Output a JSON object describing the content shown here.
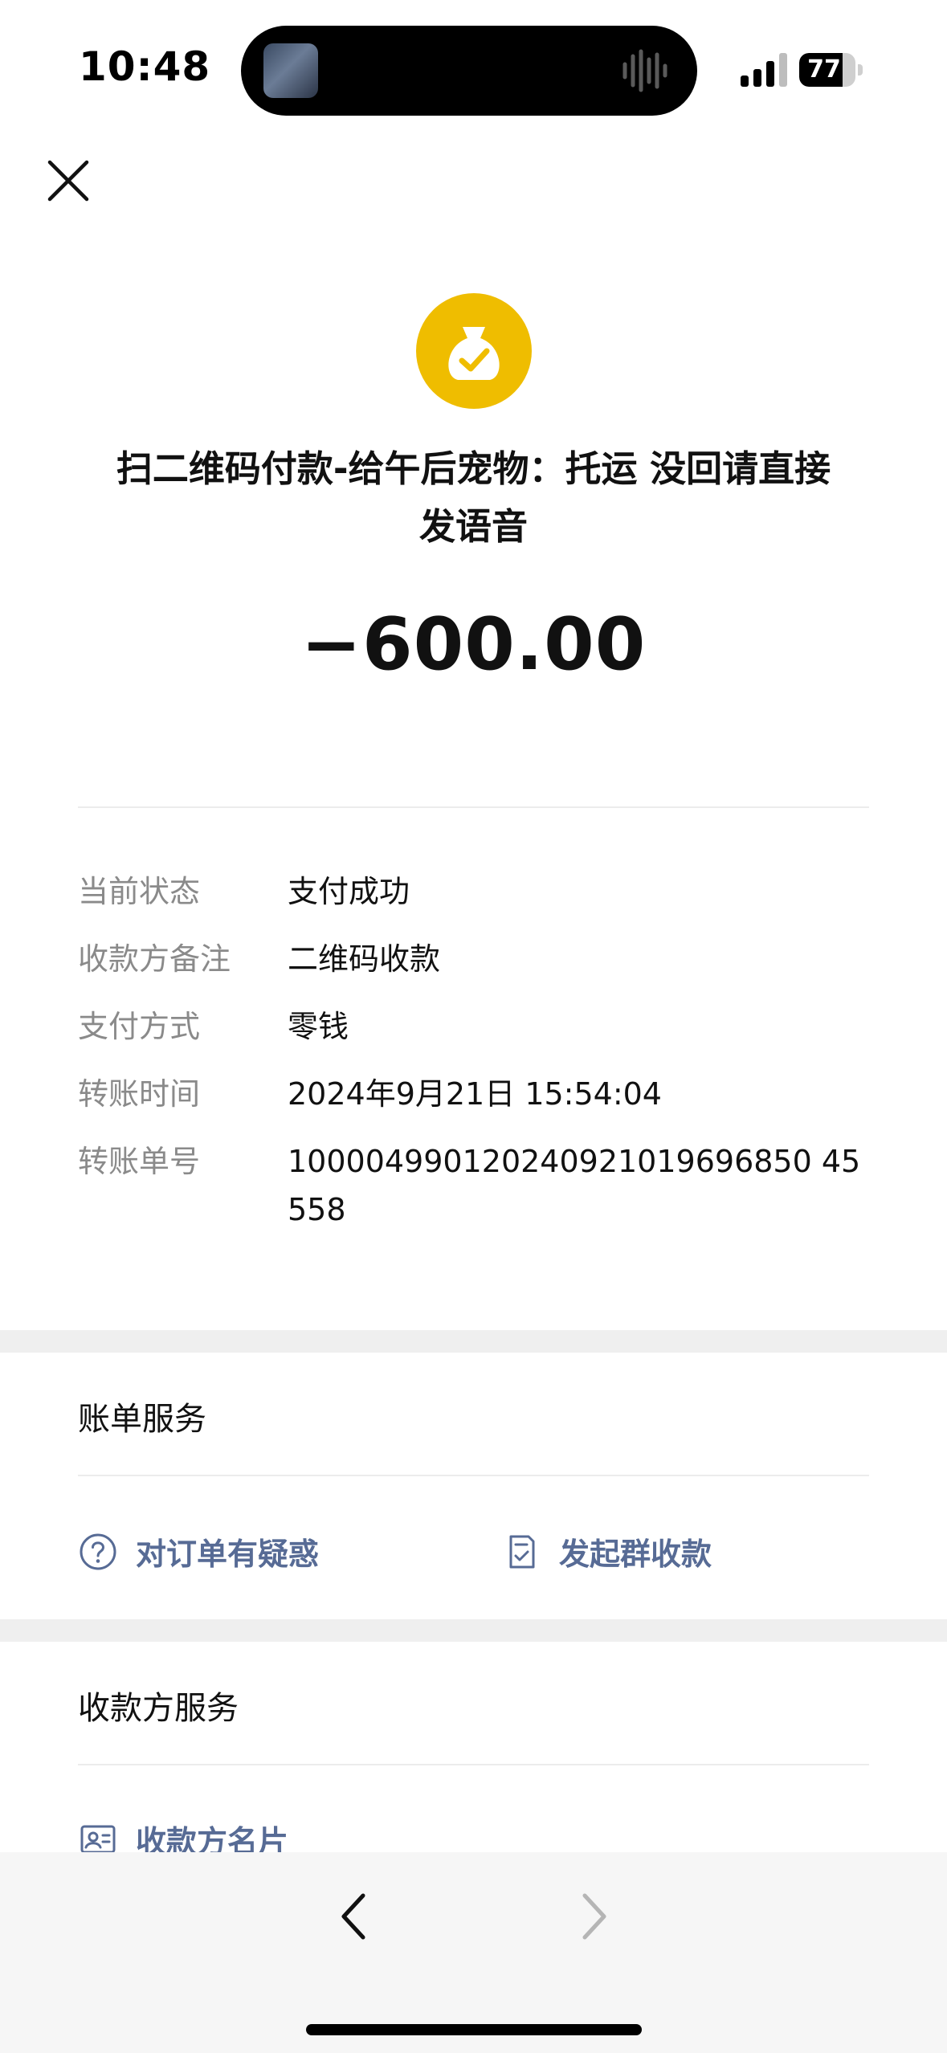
{
  "status_bar": {
    "time": "10:48",
    "battery_level": "77",
    "battery_fraction": 0.77
  },
  "header": {
    "close_icon": "close-icon",
    "status_icon": "money-bag-check-icon",
    "status_color": "#EFBD00",
    "merchant_line1": "扫二维码付款-给午后宠物：托运 没回请直接",
    "merchant_line2": "发语音",
    "amount": "−600.00"
  },
  "details": [
    {
      "label": "当前状态",
      "value": "支付成功"
    },
    {
      "label": "收款方备注",
      "value": "二维码收款"
    },
    {
      "label": "支付方式",
      "value": "零钱"
    },
    {
      "label": "转账时间",
      "value": "2024年9月21日 15:54:04"
    },
    {
      "label": "转账单号",
      "value": "100004990120240921019696850 45558"
    }
  ],
  "bill_service": {
    "title": "账单服务",
    "question_label": "对订单有疑惑",
    "question_icon": "question-circle-icon",
    "group_collect_label": "发起群收款",
    "group_collect_icon": "document-check-icon"
  },
  "payee_service": {
    "title": "收款方服务",
    "card_label": "收款方名片",
    "card_icon": "contact-card-icon"
  },
  "colors": {
    "link": "#576B95",
    "label_gray": "#8A8A8A",
    "separator": "#EFEFEF"
  }
}
